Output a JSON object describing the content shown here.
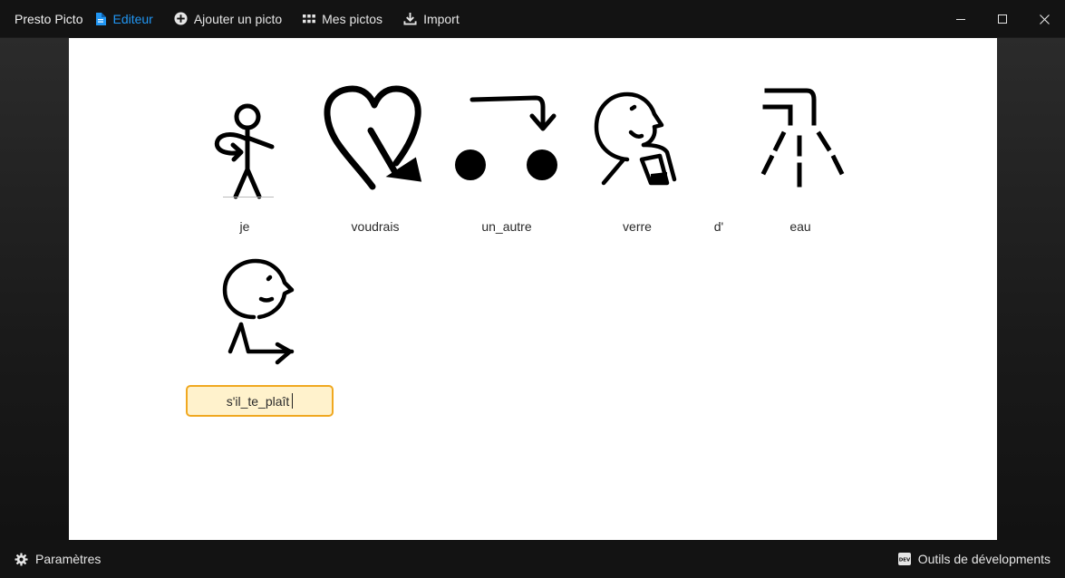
{
  "titlebar": {
    "app_title": "Presto Picto",
    "nav": [
      {
        "label": "Editeur",
        "icon": "document-icon",
        "active": true
      },
      {
        "label": "Ajouter un picto",
        "icon": "add-circle-icon",
        "active": false
      },
      {
        "label": "Mes pictos",
        "icon": "grid-icon",
        "active": false
      },
      {
        "label": "Import",
        "icon": "download-icon",
        "active": false
      }
    ],
    "window_controls": [
      "minimize-icon",
      "maximize-icon",
      "close-icon"
    ]
  },
  "editor": {
    "pictos": [
      {
        "label": "je",
        "icon": "person-pointing-self-pictogram"
      },
      {
        "label": "voudrais",
        "icon": "heart-want-pictogram"
      },
      {
        "label": "un_autre",
        "icon": "another-arrow-pictogram"
      },
      {
        "label": "verre",
        "icon": "person-drinking-glass-pictogram"
      },
      {
        "label": "d'",
        "icon": ""
      },
      {
        "label": "eau",
        "icon": "water-tap-pictogram"
      },
      {
        "label": "s'il_te_plaît",
        "icon": "person-bowing-please-pictogram",
        "editing": true
      }
    ]
  },
  "statusbar": {
    "settings_label": "Paramètres",
    "settings_icon": "gear-icon",
    "devtools_label": "Outils de dévelopments",
    "devtools_icon": "dev-badge-icon"
  },
  "colors": {
    "accent": "#2196f3",
    "edit_border": "#f0a820",
    "edit_background": "#fff2cc",
    "chrome": "#131313"
  }
}
